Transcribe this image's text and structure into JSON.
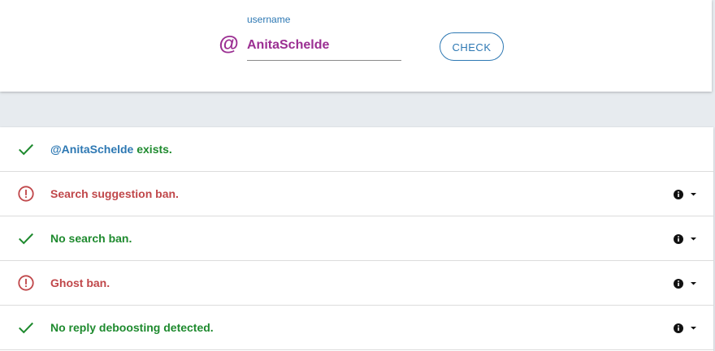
{
  "search": {
    "label": "username",
    "value": "AnitaSchelde",
    "prefix_icon": "at-sign-icon",
    "button_label": "CHECK"
  },
  "colors": {
    "accent": "#2d78b3",
    "username": "#9b2f92",
    "ok": "#1e8a2e",
    "warn": "#c0474a",
    "background": "#e7ebef"
  },
  "results": {
    "exists": {
      "status": "ok",
      "icon": "checkmark-icon",
      "user": "@AnitaSchelde",
      "text": " exists."
    },
    "search_suggestion": {
      "status": "warn",
      "icon": "alert-circle-icon",
      "text": "Search suggestion ban.",
      "has_info": true
    },
    "search_ban": {
      "status": "ok",
      "icon": "checkmark-icon",
      "text": "No search ban.",
      "has_info": true
    },
    "ghost_ban": {
      "status": "warn",
      "icon": "alert-circle-icon",
      "text": "Ghost ban.",
      "has_info": true
    },
    "reply_deboosting": {
      "status": "ok",
      "icon": "checkmark-icon",
      "text": "No reply deboosting detected.",
      "has_info": true
    }
  }
}
